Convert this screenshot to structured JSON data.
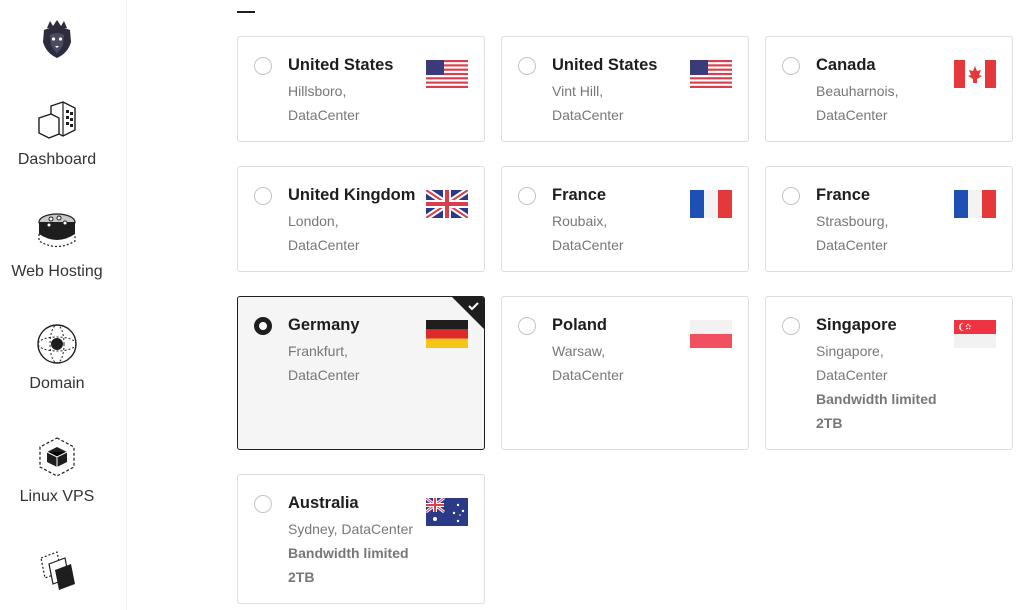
{
  "sidebar": {
    "items": [
      {
        "label": "Dashboard",
        "icon": "building-icon"
      },
      {
        "label": "Web Hosting",
        "icon": "server-icon"
      },
      {
        "label": "Domain",
        "icon": "globe-icon"
      },
      {
        "label": "Linux VPS",
        "icon": "cube-icon"
      },
      {
        "label": "",
        "icon": "layers-icon"
      }
    ]
  },
  "locations": [
    {
      "country": "United States",
      "city": "Hillsboro,",
      "type": "DataCenter",
      "note": "",
      "flag": "us",
      "selected": false
    },
    {
      "country": "United States",
      "city": "Vint Hill,",
      "type": "DataCenter",
      "note": "",
      "flag": "us",
      "selected": false
    },
    {
      "country": "Canada",
      "city": "Beauharnois,",
      "type": "DataCenter",
      "note": "",
      "flag": "ca",
      "selected": false
    },
    {
      "country": "United Kingdom",
      "city": "London,",
      "type": "DataCenter",
      "note": "",
      "flag": "gb",
      "selected": false
    },
    {
      "country": "France",
      "city": "Roubaix,",
      "type": "DataCenter",
      "note": "",
      "flag": "fr",
      "selected": false
    },
    {
      "country": "France",
      "city": "Strasbourg,",
      "type": "DataCenter",
      "note": "",
      "flag": "fr",
      "selected": false
    },
    {
      "country": "Germany",
      "city": "Frankfurt,",
      "type": "DataCenter",
      "note": "",
      "flag": "de",
      "selected": true
    },
    {
      "country": "Poland",
      "city": "Warsaw,",
      "type": "DataCenter",
      "note": "",
      "flag": "pl",
      "selected": false
    },
    {
      "country": "Singapore",
      "city": "Singapore,",
      "type": "DataCenter",
      "note": "Bandwidth limited 2TB",
      "flag": "sg",
      "selected": false
    },
    {
      "country": "Australia",
      "city": "Sydney, DataCenter",
      "type": "",
      "note": "Bandwidth limited 2TB",
      "flag": "au",
      "selected": false
    }
  ],
  "colors": {
    "accent": "#1e1e1e",
    "border": "#dddddd",
    "muted": "#777777",
    "selected_bg": "#f5f5f5"
  }
}
